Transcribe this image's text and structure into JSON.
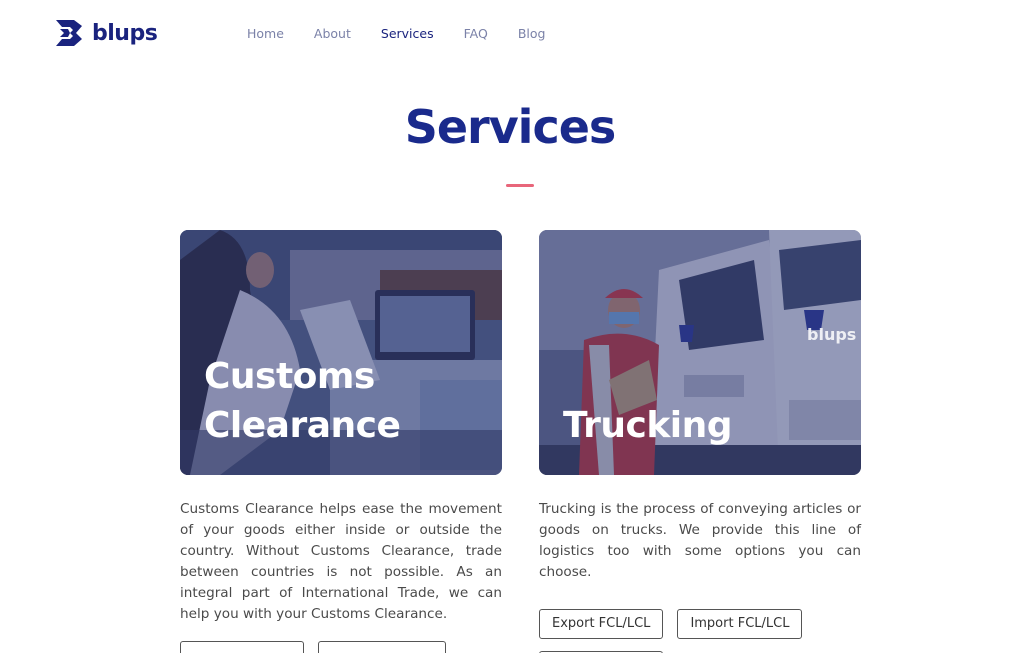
{
  "brand": {
    "name": "blups",
    "color": "#1a237e"
  },
  "nav": {
    "items": [
      {
        "label": "Home",
        "active": false
      },
      {
        "label": "About",
        "active": false
      },
      {
        "label": "Services",
        "active": true
      },
      {
        "label": "FAQ",
        "active": false
      },
      {
        "label": "Blog",
        "active": false
      }
    ]
  },
  "page": {
    "title": "Services",
    "accent": "#e8667a"
  },
  "services": [
    {
      "title_line1": "Customs",
      "title_line2": "Clearance",
      "description": "Customs Clearance helps ease the movement of your goods either inside or outside the country. Without Customs Clearance, trade between countries is not possible. As an integral part of International Trade, we can help you with your Customs Clearance."
    },
    {
      "title_line1": "Trucking",
      "description": "Trucking is the process of conveying articles or goods on trucks. We provide this line of logistics too with some options you can choose.",
      "buttons": [
        "Export FCL/LCL",
        "Import FCL/LCL"
      ]
    }
  ]
}
